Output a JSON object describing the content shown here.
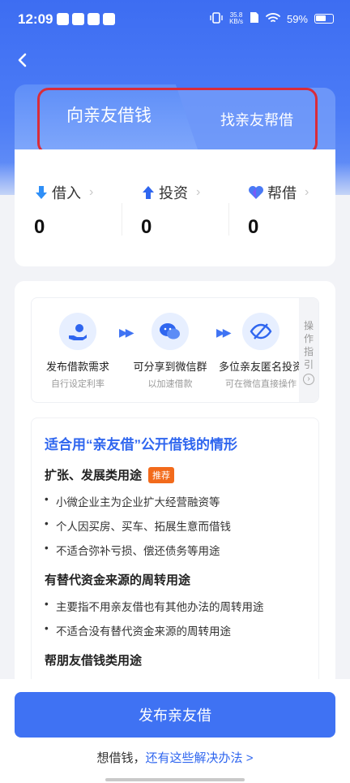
{
  "status": {
    "time": "12:09",
    "net_speed_top": "35.8",
    "net_speed_unit": "KB/s",
    "battery": "59%"
  },
  "tabs": {
    "active": "向亲友借钱",
    "inactive": "找亲友帮借"
  },
  "stats": {
    "borrow": {
      "label": "借入",
      "value": "0",
      "icon": "arrow-down-icon"
    },
    "invest": {
      "label": "投资",
      "value": "0",
      "icon": "arrow-up-icon"
    },
    "help": {
      "label": "帮借",
      "value": "0",
      "icon": "heart-icon"
    }
  },
  "steps": [
    {
      "title": "发布借款需求",
      "sub": "自行设定利率",
      "icon": "hand-money-icon"
    },
    {
      "title": "可分享到微信群",
      "sub": "以加速借款",
      "icon": "wechat-icon"
    },
    {
      "title": "多位亲友匿名投资",
      "sub": "可在微信直接操作",
      "icon": "eye-slash-icon"
    }
  ],
  "guide": {
    "label": "操作指引"
  },
  "info": {
    "title": "适合用“亲友借”公开借钱的情形",
    "sections": [
      {
        "heading": "扩张、发展类用途",
        "tag": "推荐",
        "items": [
          "小微企业主为企业扩大经营融资等",
          "个人因买房、买车、拓展生意而借钱",
          "不适合弥补亏损、偿还债务等用途"
        ]
      },
      {
        "heading": "有替代资金来源的周转用途",
        "items": [
          "主要指不用亲友借也有其他办法的周转用途",
          "不适合没有替代资金来源的周转用途"
        ]
      },
      {
        "heading": "帮朋友借钱类用途",
        "items": []
      }
    ]
  },
  "actions": {
    "primary": "发布亲友借",
    "footer_prefix": "想借钱，",
    "footer_link": "还有这些解决办法 >"
  },
  "colors": {
    "brand": "#3f72f3",
    "highlight": "#d92c3a",
    "tag": "#f26a1b"
  }
}
